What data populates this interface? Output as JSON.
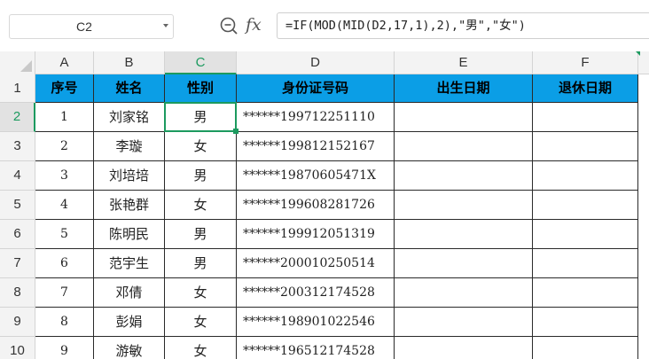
{
  "formula_bar": {
    "name_box": "C2",
    "zoom_icon": "magnifier-zoom-icon",
    "fx_icon": "fx",
    "formula": "=IF(MOD(MID(D2,17,1),2),\"男\",\"女\")"
  },
  "sheet": {
    "columns": [
      "A",
      "B",
      "C",
      "D",
      "E",
      "F"
    ],
    "selected_column": "C",
    "rows": [
      "1",
      "2",
      "3",
      "4",
      "5",
      "6",
      "7",
      "8",
      "9",
      "10"
    ],
    "selected_row": "2",
    "header_fill_color": "#0b9ee6",
    "selection_color": "#1c9a5f",
    "headers": [
      "序号",
      "姓名",
      "性别",
      "身份证号码",
      "出生日期",
      "退休日期"
    ],
    "data": [
      [
        "1",
        "刘家铭",
        "男",
        "******199712251110",
        "",
        ""
      ],
      [
        "2",
        "李璇",
        "女",
        "******199812152167",
        "",
        ""
      ],
      [
        "3",
        "刘培培",
        "男",
        "******19870605471X",
        "",
        ""
      ],
      [
        "4",
        "张艳群",
        "女",
        "******199608281726",
        "",
        ""
      ],
      [
        "5",
        "陈明民",
        "男",
        "******199912051319",
        "",
        ""
      ],
      [
        "6",
        "范宇生",
        "男",
        "******200010250514",
        "",
        ""
      ],
      [
        "7",
        "邓倩",
        "女",
        "******200312174528",
        "",
        ""
      ],
      [
        "8",
        "彭娟",
        "女",
        "******198901022546",
        "",
        ""
      ],
      [
        "9",
        "游敏",
        "女",
        "******196512174528",
        "",
        ""
      ]
    ]
  }
}
